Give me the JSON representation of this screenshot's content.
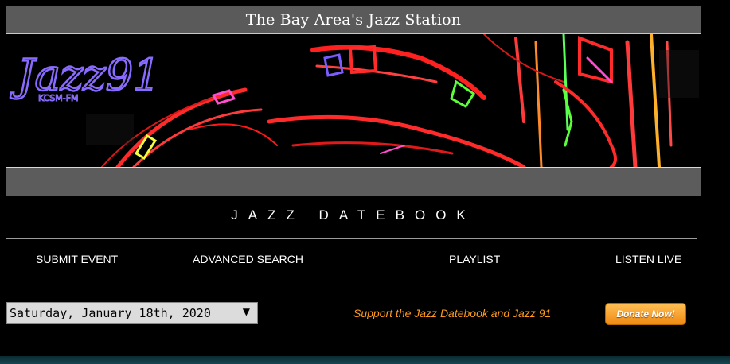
{
  "header": {
    "tagline": "The Bay Area's Jazz Station"
  },
  "banner": {
    "logo_text": "Jazz91",
    "logo_subtext": "KCSM-FM"
  },
  "section": {
    "title": "JAZZ DATEBOOK"
  },
  "nav": {
    "submit_event": "SUBMIT EVENT",
    "advanced_search": "ADVANCED SEARCH",
    "playlist": "PLAYLIST",
    "listen_live": "LISTEN LIVE"
  },
  "date_select": {
    "value": "Saturday, January 18th, 2020",
    "arrow": "▼"
  },
  "support": {
    "text": "Support the Jazz Datebook and Jazz 91",
    "donate_label": "Donate Now!"
  },
  "colors": {
    "accent": "#ff9a1c",
    "bar": "#5a5a5a",
    "background": "#000000"
  }
}
